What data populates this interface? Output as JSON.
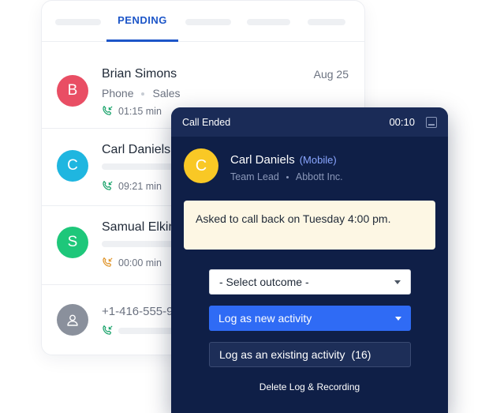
{
  "tabs": {
    "active_label": "PENDING"
  },
  "calls": [
    {
      "initial": "B",
      "name": "Brian Simons",
      "date": "Aug 25",
      "type": "Phone",
      "team": "Sales",
      "duration": "01:15 min",
      "avatar_color": "#e94e64",
      "phone_color": "#1aa36b"
    },
    {
      "initial": "C",
      "name": "Carl Daniels",
      "duration": "09:21 min",
      "avatar_color": "#1fb6e0",
      "phone_color": "#1aa36b"
    },
    {
      "initial": "S",
      "name": "Samual Elkins",
      "duration": "00:00 min",
      "avatar_color": "#1ec77a",
      "phone_color": "#e0952b"
    },
    {
      "name": "+1-416-555-9",
      "avatar_color": "#8a909c",
      "phone_color": "#1aa36b",
      "avatar_icon": "user-icon"
    }
  ],
  "panel": {
    "title": "Call Ended",
    "timer": "00:10",
    "contact": {
      "initial": "C",
      "name": "Carl Daniels",
      "phone_type": "(Mobile)",
      "role": "Team Lead",
      "company": "Abbott Inc."
    },
    "note": "Asked to call back on Tuesday 4:00 pm.",
    "outcome_select": "- Select outcome -",
    "log_new_label": "Log as new activity",
    "log_existing_label": "Log as an existing activity",
    "log_existing_count": "(16)",
    "delete_label": "Delete Log & Recording",
    "accent": "#2f6bf5",
    "background": "#0f1f47"
  }
}
